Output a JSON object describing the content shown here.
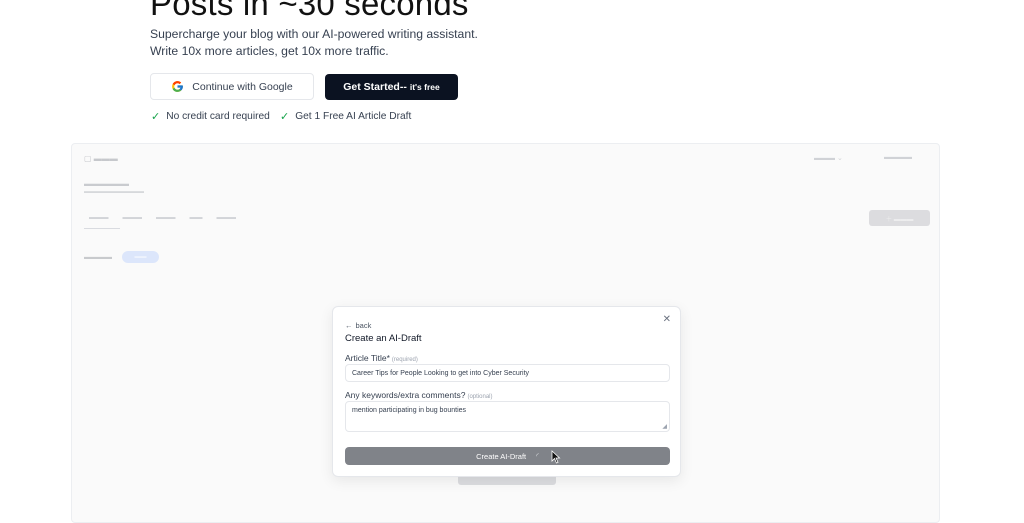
{
  "hero": {
    "headline": "Posts in ~30 seconds",
    "sub1": "Supercharge your blog with our AI-powered writing assistant.",
    "sub2": "Write 10x more articles, get 10x more traffic."
  },
  "cta": {
    "google_label": "Continue with Google",
    "start_label": "Get Started--",
    "start_suffix": "it's free"
  },
  "perks": [
    "No credit card required",
    "Get 1 Free AI Article Draft"
  ],
  "modal": {
    "back_label": "back",
    "title": "Create an AI-Draft",
    "title_field": {
      "label": "Article Title*",
      "hint": "(required)",
      "value": "Career Tips for People Looking to get into Cyber Security"
    },
    "keywords_field": {
      "label": "Any keywords/extra comments?",
      "hint": "(optional)",
      "value": "mention participating in bug bounties"
    },
    "submit_label": "Create AI-Draft"
  },
  "colors": {
    "primary_dark": "#0b1221",
    "check": "#16a34a",
    "submit_disabled": "#808389"
  }
}
